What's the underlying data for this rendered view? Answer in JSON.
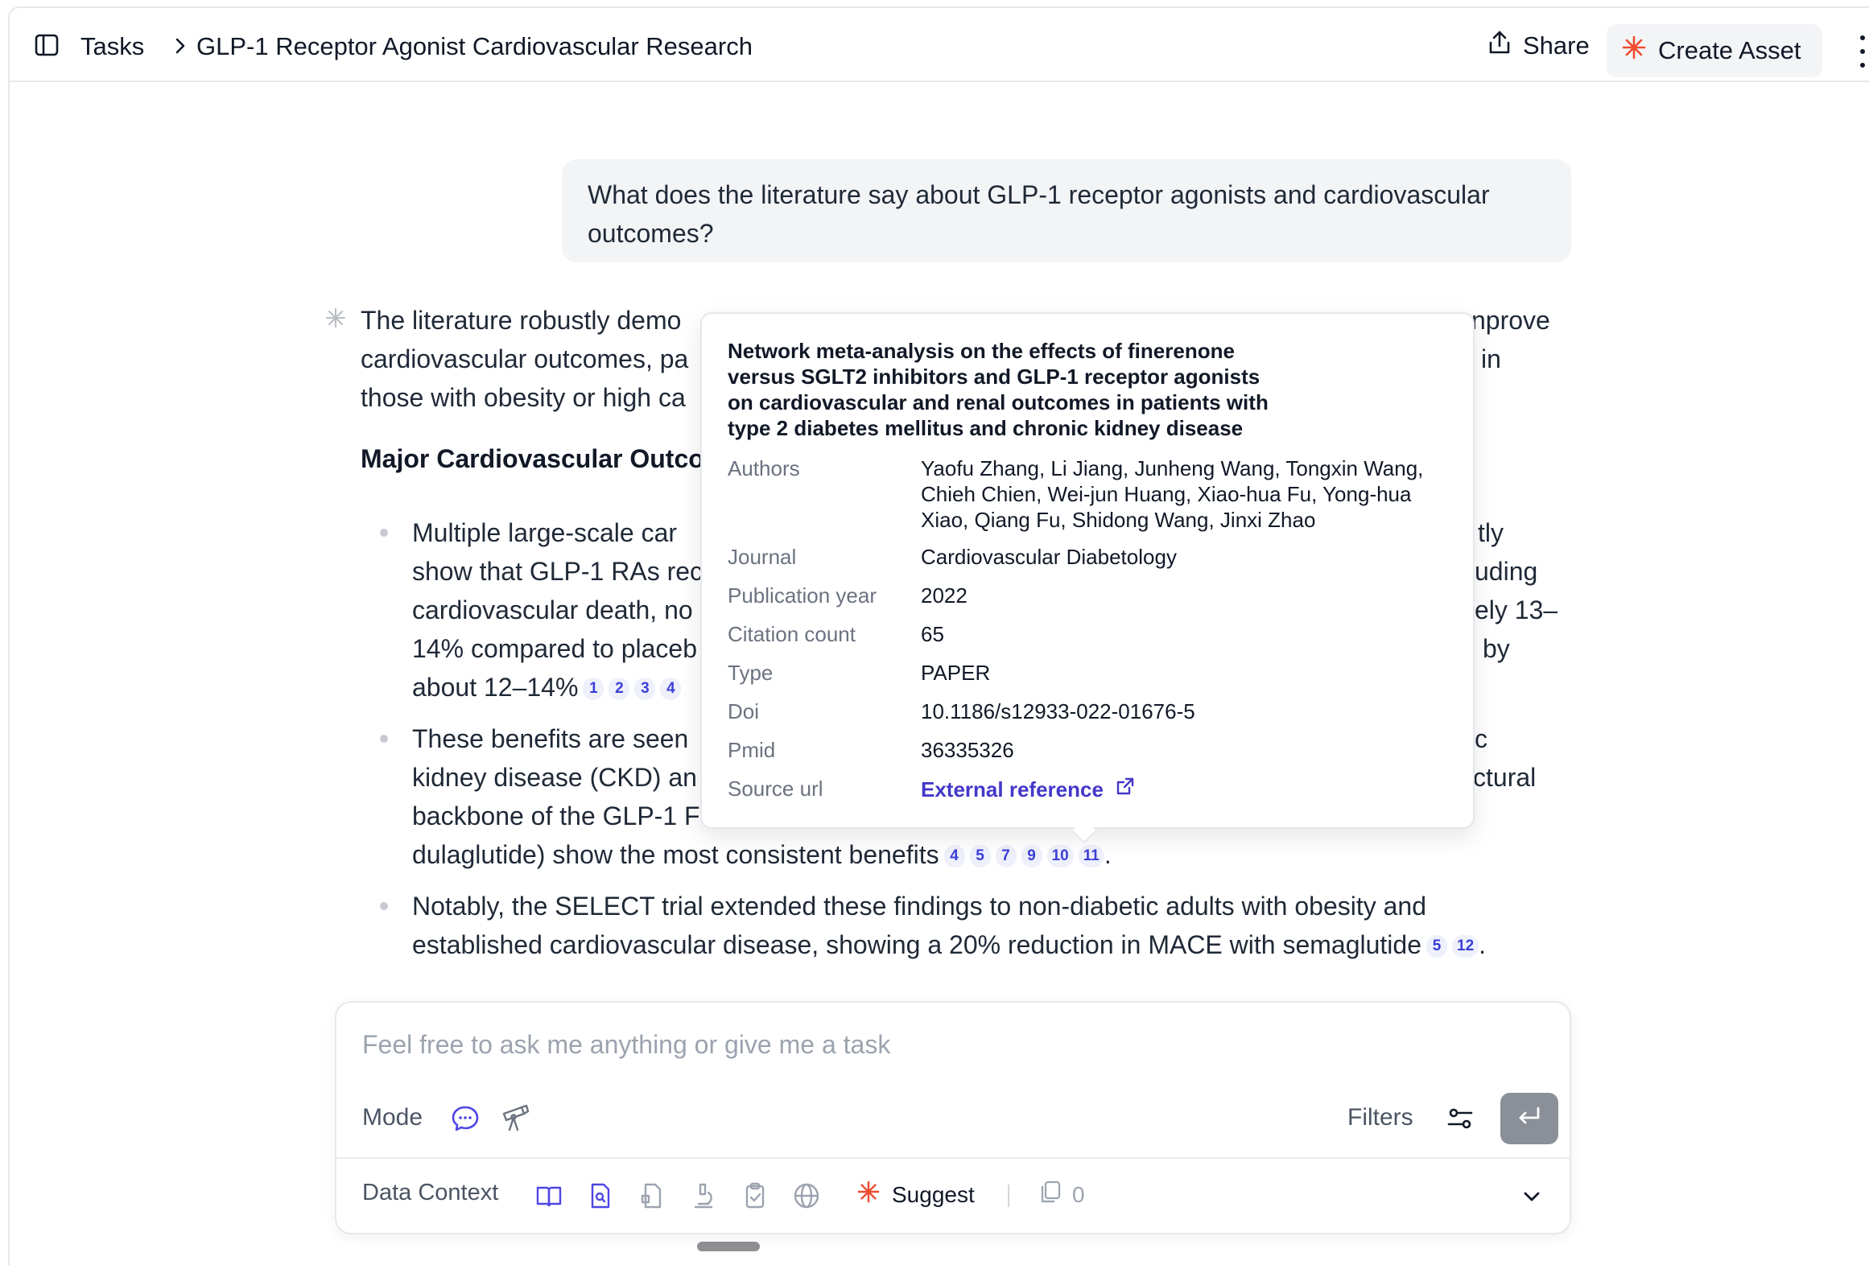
{
  "header": {
    "breadcrumb_tasks": "Tasks",
    "title": "GLP-1 Receptor Agonist Cardiovascular Research",
    "share_label": "Share",
    "create_label": "Create Asset",
    "accent": "#ef4b2f"
  },
  "user_message": "What does the literature say about GLP-1 receptor agonists and cardiovascular outcomes?",
  "answer": {
    "para1_line1_left": "The literature robustly demo",
    "para1_line1_right": "nprove",
    "para1_line2_left": "cardiovascular outcomes, pa",
    "para1_line2_right": "in",
    "para1_line3_left": "those with obesity or high ca",
    "heading": "Major Cardiovascular Outco",
    "bullet1": {
      "l1_left": "Multiple large-scale car",
      "l1_right": "tly",
      "l2_left": "show that GLP-1 RAs rec",
      "l2_right": "uding",
      "l3_left": "cardiovascular death, no",
      "l3_right": "ely 13–",
      "l4_left": "14% compared to placeb",
      "l4_right": "by",
      "l5_left": "about 12–14%",
      "cites": [
        "1",
        "2",
        "3",
        "4"
      ]
    },
    "bullet2": {
      "l1_left": "These benefits are seen",
      "l1_right": "c",
      "l2_left": "kidney disease (CKD) an",
      "l2_right": "ctural",
      "l3_left": "backbone of the GLP-1 F",
      "l4": "dulaglutide) show the most consistent benefits",
      "cites": [
        "4",
        "5",
        "7",
        "9",
        "10",
        "11"
      ],
      "end": "."
    },
    "bullet3": {
      "l1": "Notably, the SELECT trial extended these findings to non-diabetic adults with obesity and",
      "l2": "established cardiovascular disease, showing a 20% reduction in MACE with semaglutide",
      "cites": [
        "5",
        "12"
      ],
      "end": "."
    }
  },
  "popover": {
    "title": "Network meta-analysis on the effects of finerenone versus SGLT2 inhibitors and GLP-1 receptor agonists on cardiovascular and renal outcomes in patients with type 2 diabetes mellitus and chronic kidney disease",
    "authors_key": "Authors",
    "authors": "Yaofu Zhang, Li Jiang, Junheng Wang, Tongxin Wang, Chieh Chien, Wei-jun Huang, Xiao-hua Fu, Yong-hua Xiao, Qiang Fu, Shidong Wang, Jinxi Zhao",
    "journal_key": "Journal",
    "journal": "Cardiovascular Diabetology",
    "year_key": "Publication year",
    "year": "2022",
    "citations_key": "Citation count",
    "citations": "65",
    "type_key": "Type",
    "type": "PAPER",
    "doi_key": "Doi",
    "doi": "10.1186/s12933-022-01676-5",
    "pmid_key": "Pmid",
    "pmid": "36335326",
    "source_key": "Source url",
    "source_link": "External reference"
  },
  "composer": {
    "placeholder": "Feel free to ask me anything or give me a task",
    "mode_label": "Mode",
    "filters_label": "Filters",
    "data_context_label": "Data Context",
    "suggest_label": "Suggest",
    "count": "0"
  }
}
